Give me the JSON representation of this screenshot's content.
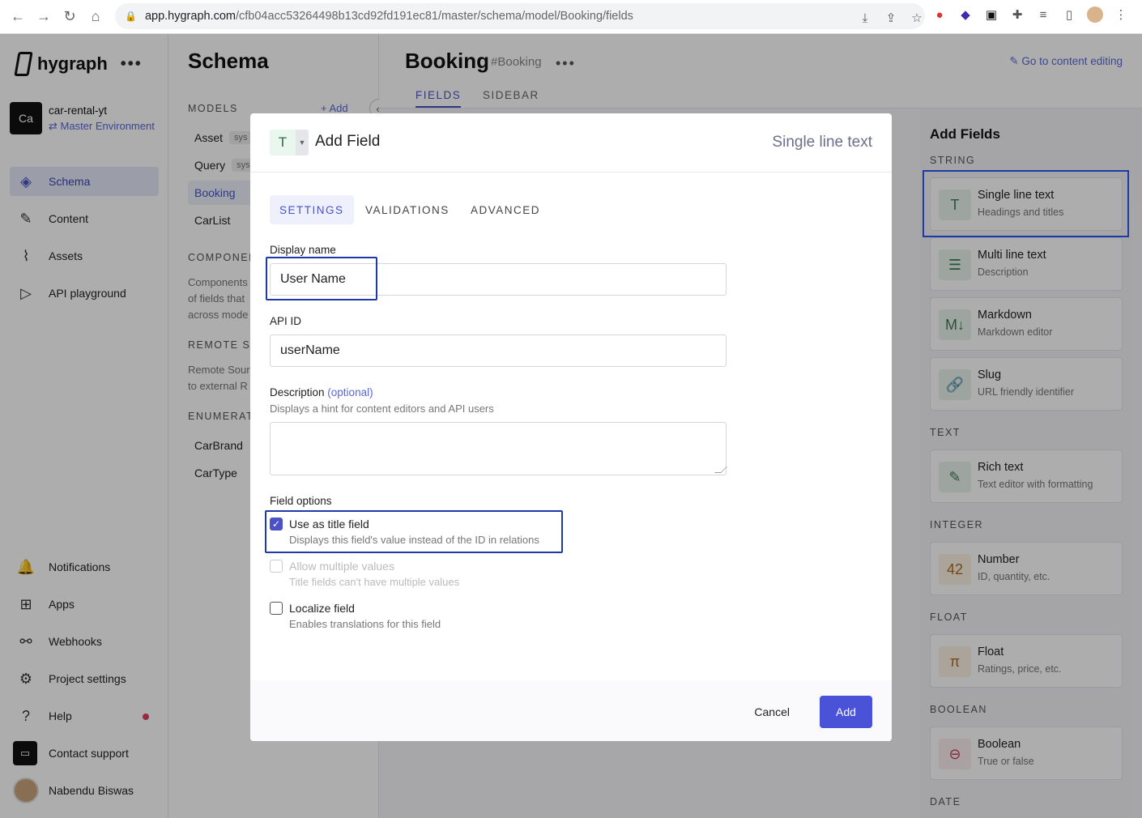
{
  "browser": {
    "url_domain": "app.hygraph.com",
    "url_path": "/cfb04acc53264498b13cd92fd191ec81/master/schema/model/Booking/fields"
  },
  "sidebar": {
    "brand": "hygraph",
    "project_initials": "Ca",
    "project_name": "car-rental-yt",
    "environment": "Master Environment",
    "nav": [
      {
        "label": "Schema",
        "icon": "layers-icon"
      },
      {
        "label": "Content",
        "icon": "edit-icon"
      },
      {
        "label": "Assets",
        "icon": "paperclip-icon"
      },
      {
        "label": "API playground",
        "icon": "play-icon"
      }
    ],
    "bottom": [
      {
        "label": "Notifications",
        "icon": "bell-icon"
      },
      {
        "label": "Apps",
        "icon": "grid-icon"
      },
      {
        "label": "Webhooks",
        "icon": "webhook-icon"
      },
      {
        "label": "Project settings",
        "icon": "gear-icon"
      },
      {
        "label": "Help",
        "icon": "help-icon"
      },
      {
        "label": "Contact support",
        "icon": "chat-icon"
      }
    ],
    "user_name": "Nabendu Biswas"
  },
  "schema": {
    "title": "Schema",
    "models_label": "MODELS",
    "add_label": "Add",
    "models": [
      "Asset",
      "Query",
      "Booking",
      "CarList"
    ],
    "system_badge": "sys",
    "components_label": "COMPONEN",
    "components_desc": [
      "Components",
      "of fields that",
      "across mode"
    ],
    "remote_label": "REMOTE SC",
    "remote_desc": [
      "Remote Sour",
      "to external R"
    ],
    "enum_label": "ENUMERATI",
    "enums": [
      "CarBrand",
      "CarType"
    ]
  },
  "main": {
    "model_name": "Booking",
    "model_id": "#Booking",
    "goto_link": "Go to content editing",
    "tabs": [
      "FIELDS",
      "SIDEBAR"
    ]
  },
  "add_fields": {
    "title": "Add Fields",
    "sections": [
      {
        "label": "STRING"
      },
      {
        "label": "TEXT"
      },
      {
        "label": "INTEGER"
      },
      {
        "label": "FLOAT"
      },
      {
        "label": "BOOLEAN"
      },
      {
        "label": "DATE"
      }
    ],
    "cards": [
      {
        "name": "Single line text",
        "sub": "Headings and titles",
        "glyph": "T",
        "bg": "#e9f4ec",
        "fg": "#3c7a52"
      },
      {
        "name": "Multi line text",
        "sub": "Description",
        "glyph": "☰",
        "bg": "#e9f4ec",
        "fg": "#3c7a52"
      },
      {
        "name": "Markdown",
        "sub": "Markdown editor",
        "glyph": "M↓",
        "bg": "#e9f4ec",
        "fg": "#3c7a52"
      },
      {
        "name": "Slug",
        "sub": "URL friendly identifier",
        "glyph": "🔗",
        "bg": "#e9f4ec",
        "fg": "#3c7a52"
      },
      {
        "name": "Rich text",
        "sub": "Text editor with formatting",
        "glyph": "✎",
        "bg": "#e9f4ec",
        "fg": "#3c7a52"
      },
      {
        "name": "Number",
        "sub": "ID, quantity, etc.",
        "glyph": "42",
        "bg": "#fbf2e4",
        "fg": "#b06a1c"
      },
      {
        "name": "Float",
        "sub": "Ratings, price, etc.",
        "glyph": "π",
        "bg": "#fbf2e4",
        "fg": "#b06a1c"
      },
      {
        "name": "Boolean",
        "sub": "True or false",
        "glyph": "⊖",
        "bg": "#fbeef0",
        "fg": "#c0405a"
      }
    ]
  },
  "modal": {
    "type_glyph": "T",
    "title": "Add Field",
    "field_type": "Single line text",
    "tabs": [
      "SETTINGS",
      "VALIDATIONS",
      "ADVANCED"
    ],
    "display_name_label": "Display name",
    "display_name_value": "User Name",
    "api_id_label": "API ID",
    "api_id_value": "userName",
    "description_label": "Description",
    "description_optional": "(optional)",
    "description_hint": "Displays a hint for content editors and API users",
    "field_options_label": "Field options",
    "options": [
      {
        "title": "Use as title field",
        "sub": "Displays this field's value instead of the ID in relations",
        "checked": true,
        "disabled": false
      },
      {
        "title": "Allow multiple values",
        "sub": "Title fields can't have multiple values",
        "checked": false,
        "disabled": true
      },
      {
        "title": "Localize field",
        "sub": "Enables translations for this field",
        "checked": false,
        "disabled": false
      }
    ],
    "cancel_label": "Cancel",
    "add_label": "Add"
  }
}
